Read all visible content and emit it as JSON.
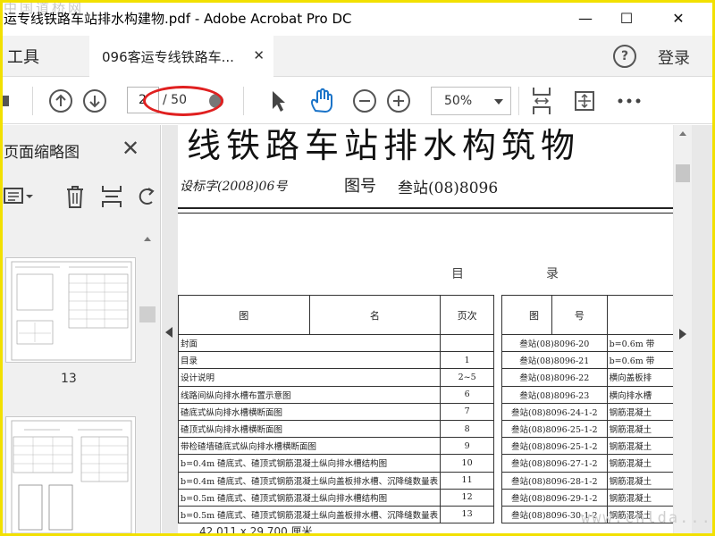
{
  "window": {
    "title": "运专线铁路车站排水构建物.pdf - Adobe Acrobat Pro DC",
    "watermark": "中国道桥网",
    "minimize": "—",
    "maximize": "☐",
    "close": "✕"
  },
  "tabs": {
    "tools": "工具",
    "document": "096客运专线铁路车...",
    "close": "✕",
    "help": "?",
    "login": "登录"
  },
  "toolbar": {
    "page_current": "2",
    "page_total": "/ 50",
    "zoom": "50%"
  },
  "thumbnail_panel": {
    "title": "页面缩略图",
    "close": "✕",
    "page_label": "13"
  },
  "document": {
    "title": "线铁路车站排水构筑物",
    "subtitle": "设标字(2008)06号",
    "drawing_no_label": "图号",
    "drawing_no": "叁站(08)8096",
    "contents_label_1": "目",
    "contents_label_2": "录",
    "left_headers": [
      "图",
      "名",
      "页次"
    ],
    "right_headers": [
      "图",
      "号"
    ],
    "left_rows": [
      {
        "name": "封面",
        "page": ""
      },
      {
        "name": "目录",
        "page": "1"
      },
      {
        "name": "设计说明",
        "page": "2~5"
      },
      {
        "name": "线路间纵向排水槽布置示意图",
        "page": "6"
      },
      {
        "name": "碴底式纵向排水槽横断面图",
        "page": "7"
      },
      {
        "name": "碴顶式纵向排水槽横断面图",
        "page": "8"
      },
      {
        "name": "带检碴墙碴底式纵向排水槽横断面图",
        "page": "9"
      },
      {
        "name": "b=0.4m 碴底式、碴顶式钢筋混凝土纵向排水槽结构图",
        "page": "10"
      },
      {
        "name": "b=0.4m 碴底式、碴顶式钢筋混凝土纵向盖板排水槽、沉降缝数量表",
        "page": "11"
      },
      {
        "name": "b=0.5m 碴底式、碴顶式钢筋混凝土纵向排水槽结构图",
        "page": "12"
      },
      {
        "name": "b=0.5m 碴底式、碴顶式钢筋混凝土纵向盖板排水槽、沉降缝数量表",
        "page": "13"
      }
    ],
    "right_rows": [
      {
        "code": "叁站(08)8096-20",
        "name": "b=0.6m 带"
      },
      {
        "code": "叁站(08)8096-21",
        "name": "b=0.6m 带"
      },
      {
        "code": "叁站(08)8096-22",
        "name": "横向盖板排"
      },
      {
        "code": "叁站(08)8096-23",
        "name": "横向排水槽"
      },
      {
        "code": "叁站(08)8096-24-1-2",
        "name": "钢筋混凝土"
      },
      {
        "code": "叁站(08)8096-25-1-2",
        "name": "钢筋混凝土"
      },
      {
        "code": "叁站(08)8096-25-1-2",
        "name": "钢筋混凝土"
      },
      {
        "code": "叁站(08)8096-27-1-2",
        "name": "钢筋混凝土"
      },
      {
        "code": "叁站(08)8096-28-1-2",
        "name": "钢筋混凝土"
      },
      {
        "code": "叁站(08)8096-29-1-2",
        "name": "钢筋混凝土"
      },
      {
        "code": "叁站(08)8096-30-1-2",
        "name": "钢筋混凝土"
      }
    ]
  },
  "status": {
    "page_size": "42.011 x 29.700 厘米"
  },
  "corner_watermark": "www.cnlda..."
}
